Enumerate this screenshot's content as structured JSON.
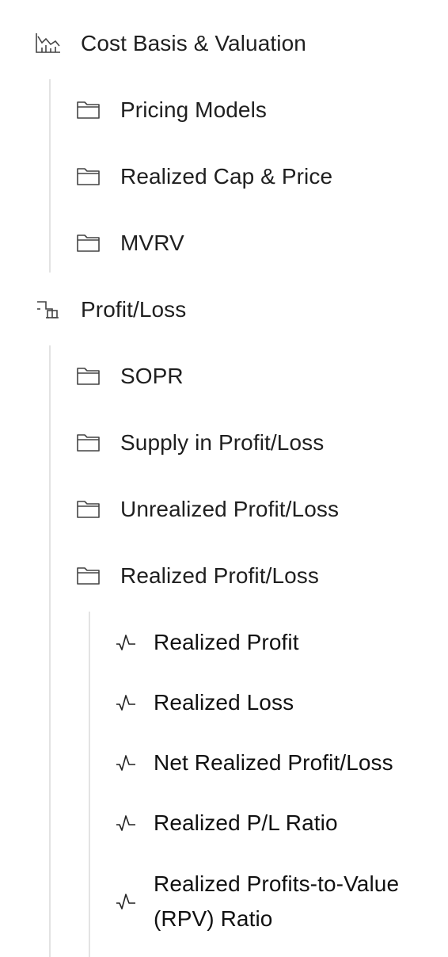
{
  "nav": {
    "sections": [
      {
        "label": "Cost Basis & Valuation",
        "icon": "chart-icon",
        "folders": [
          {
            "label": "Pricing Models",
            "icon": "folder-icon"
          },
          {
            "label": "Realized Cap & Price",
            "icon": "folder-icon"
          },
          {
            "label": "MVRV",
            "icon": "folder-icon"
          }
        ]
      },
      {
        "label": "Profit/Loss",
        "icon": "steps-icon",
        "folders": [
          {
            "label": "SOPR",
            "icon": "folder-icon"
          },
          {
            "label": "Supply in Profit/Loss",
            "icon": "folder-icon"
          },
          {
            "label": "Unrealized Profit/Loss",
            "icon": "folder-icon"
          },
          {
            "label": "Realized Profit/Loss",
            "icon": "folder-icon",
            "metrics": [
              {
                "label": "Realized Profit",
                "icon": "activity-icon"
              },
              {
                "label": "Realized Loss",
                "icon": "activity-icon"
              },
              {
                "label": "Net Realized Profit/Loss",
                "icon": "activity-icon"
              },
              {
                "label": "Realized P/L Ratio",
                "icon": "activity-icon"
              },
              {
                "label": "Realized Profits-to-Value (RPV) Ratio",
                "icon": "activity-icon"
              }
            ]
          }
        ]
      }
    ]
  }
}
